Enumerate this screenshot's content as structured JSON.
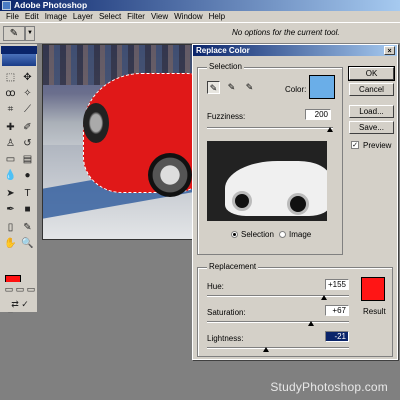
{
  "app": {
    "title": "Adobe Photoshop"
  },
  "menu": [
    "File",
    "Edit",
    "Image",
    "Layer",
    "Select",
    "Filter",
    "View",
    "Window",
    "Help"
  ],
  "options_bar": {
    "message": "No options for the current tool."
  },
  "colors": {
    "foreground": "#ff1111",
    "background": "#ffffff",
    "selection_color": "#6aaee8",
    "result_color": "#ff1515"
  },
  "dialog": {
    "title": "Replace Color",
    "close_symbol": "×",
    "buttons": {
      "ok": "OK",
      "cancel": "Cancel",
      "load": "Load...",
      "save": "Save..."
    },
    "preview": {
      "label": "Preview",
      "checked": true
    },
    "selection_group": {
      "label": "Selection",
      "color_label": "Color:",
      "fuzziness_label": "Fuzziness:",
      "fuzziness_value": "200",
      "radio_selection": "Selection",
      "radio_image": "Image",
      "selected_radio": "Selection"
    },
    "replacement_group": {
      "label": "Replacement",
      "hue_label": "Hue:",
      "hue_value": "+155",
      "saturation_label": "Saturation:",
      "saturation_value": "+67",
      "lightness_label": "Lightness:",
      "lightness_value": "-21",
      "result_label": "Result"
    }
  },
  "watermark": "StudyPhotoshop.com"
}
